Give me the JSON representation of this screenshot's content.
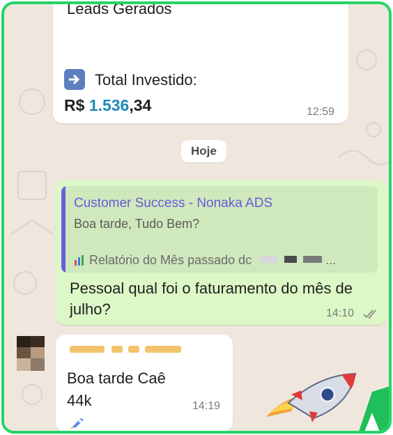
{
  "messages": {
    "first": {
      "leads_label": "Leads Gerados",
      "invest_icon": "arrow-right-icon",
      "invest_label": "Total Investido:",
      "amount_prefix": "R$",
      "amount_highlight": "1.536",
      "amount_suffix": ",34",
      "time": "12:59"
    },
    "date_chip": "Hoje",
    "reply": {
      "quoted_author": "Customer Success - Nonaka ADS",
      "quoted_text": "Boa tarde, Tudo Bem?",
      "quoted_report": "Relatório do Mês passado dc",
      "quoted_report_ellipsis": "...",
      "text": "Pessoal qual foi o faturamento do mês de julho?",
      "time": "14:10",
      "status_icon": "double-check-icon"
    },
    "incoming": {
      "text_line1": "Boa tarde Caê",
      "text_line2": "44k",
      "time": "14:19",
      "reaction_icon": "rocket-icon"
    }
  },
  "colors": {
    "frame_border": "#25d366",
    "chat_bg": "#efe7de",
    "outgoing_bubble": "#dcf8c6",
    "incoming_bubble": "#ffffff",
    "quote_accent": "#6a59d8",
    "amount_highlight": "#1f8ab8"
  }
}
